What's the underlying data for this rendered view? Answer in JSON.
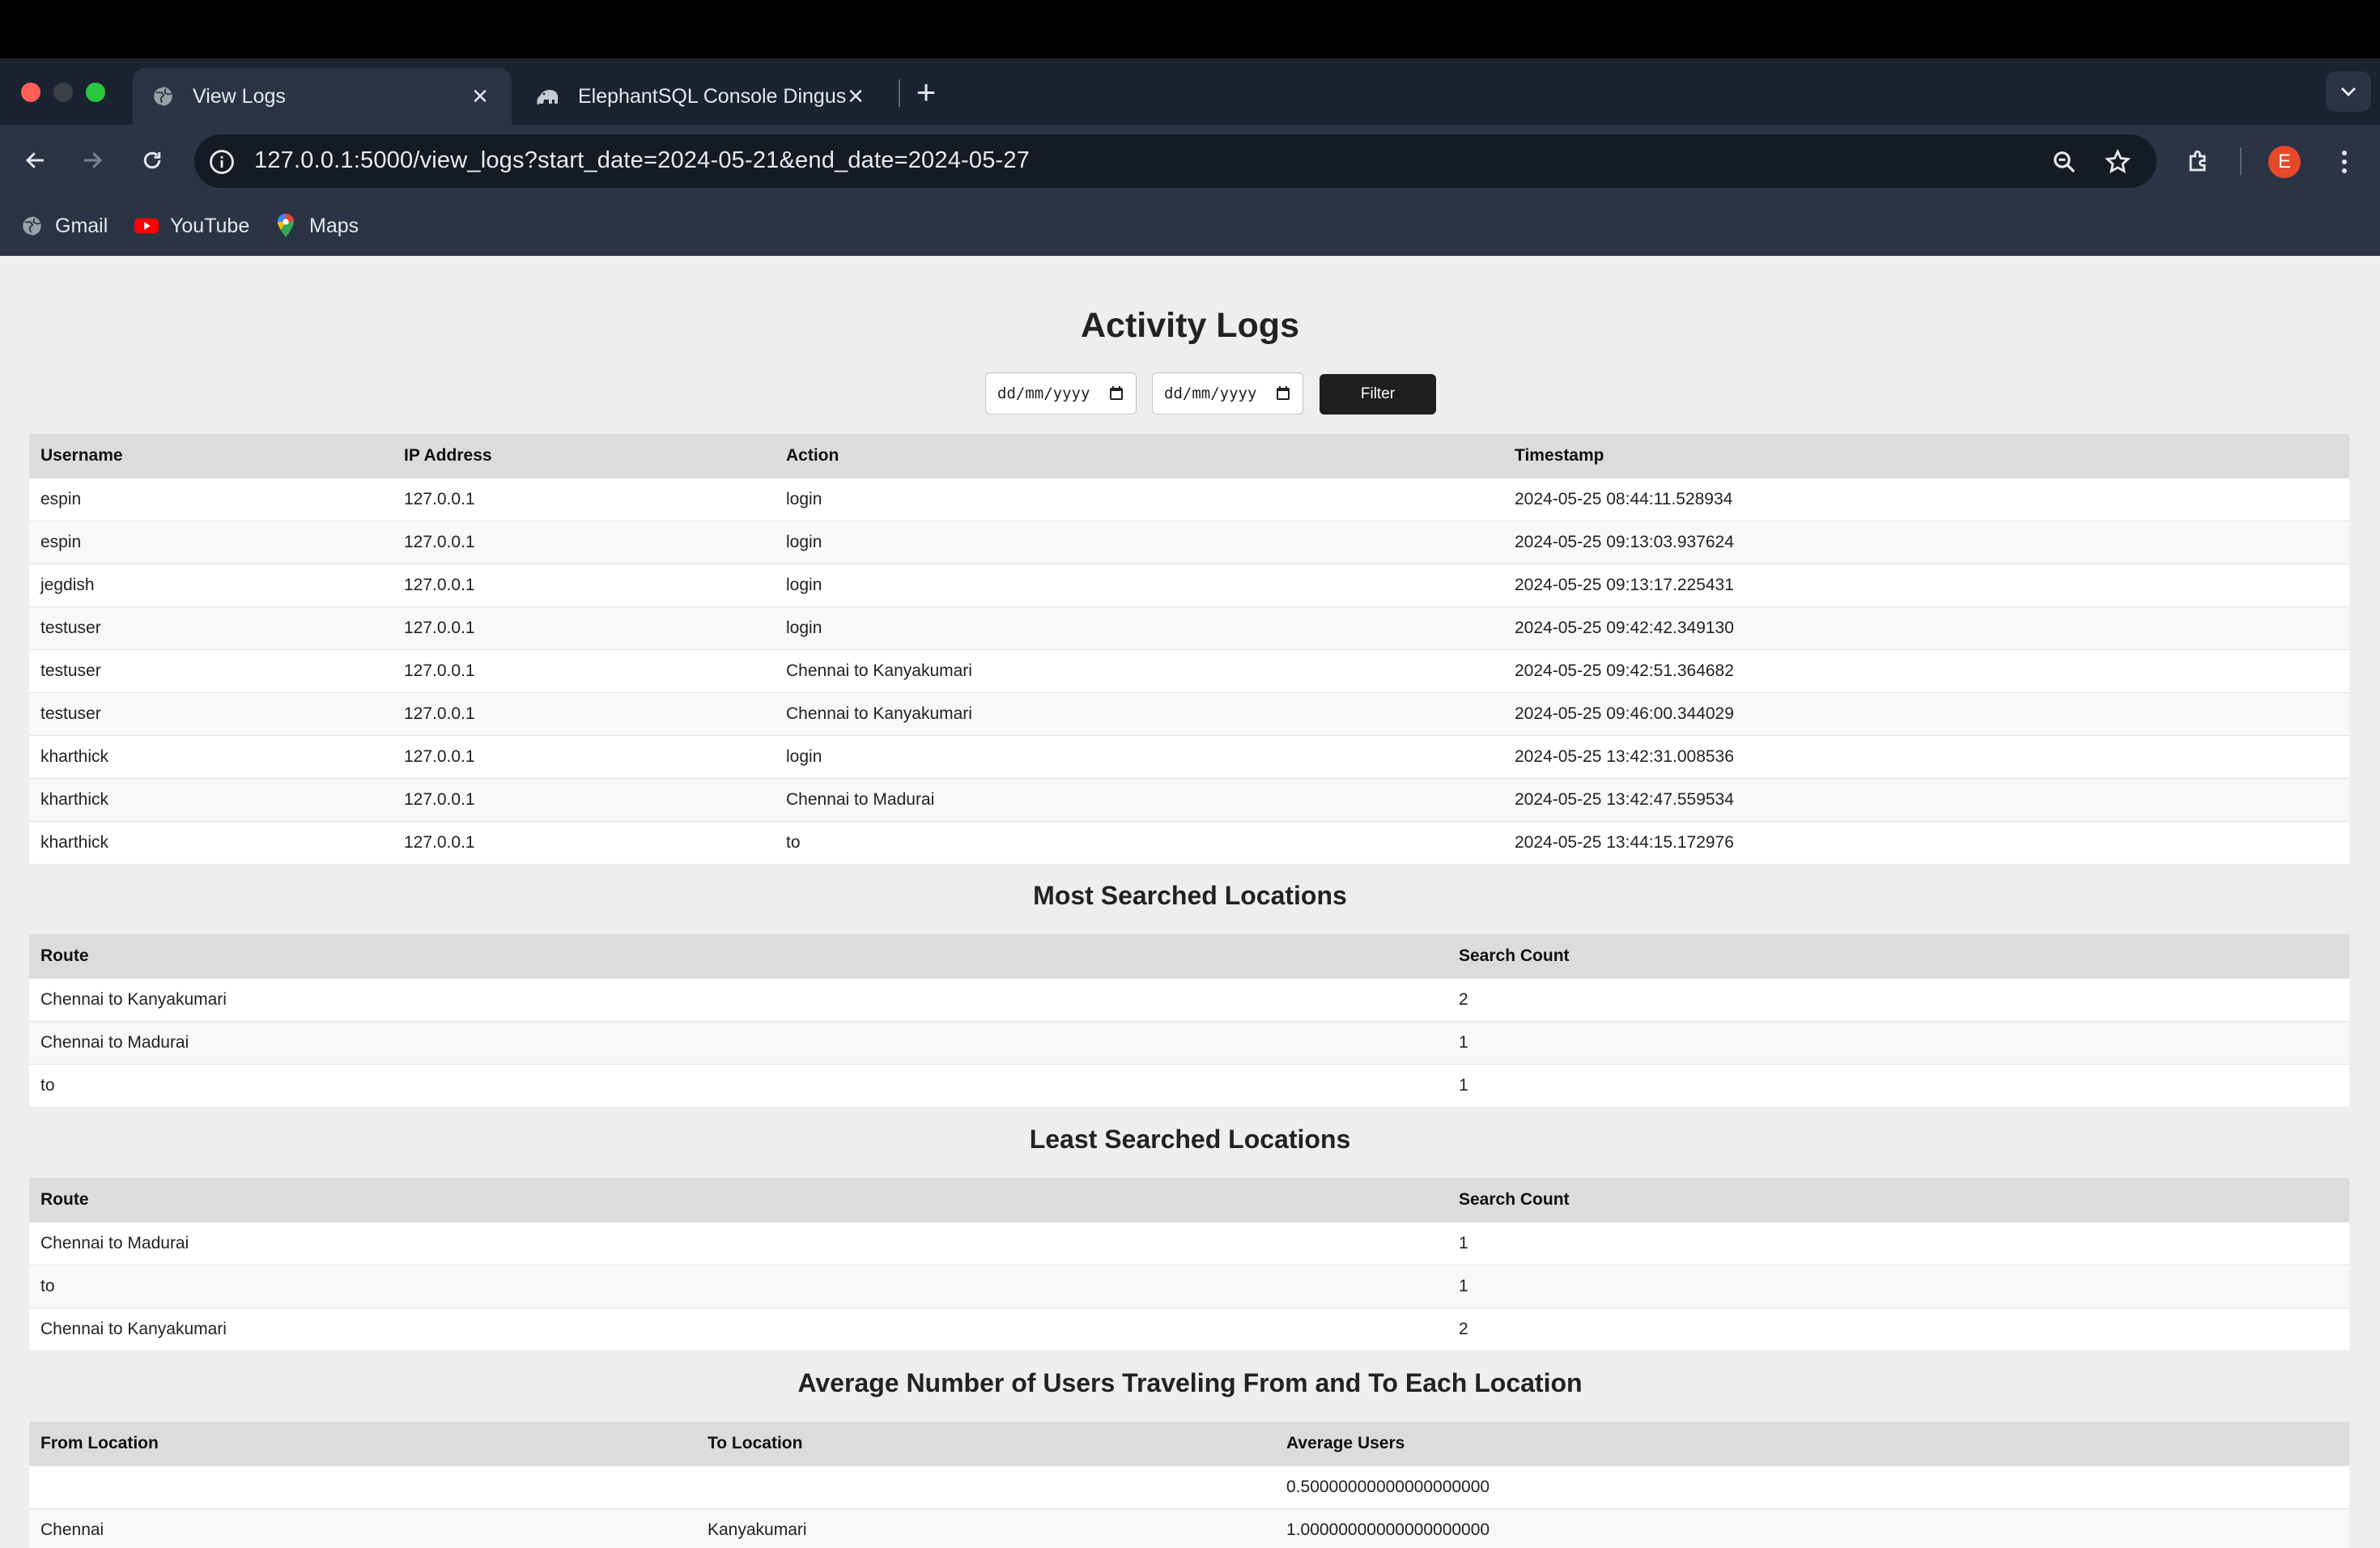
{
  "browser": {
    "tabs": [
      {
        "title": "View Logs",
        "icon": "globe-icon",
        "active": true
      },
      {
        "title": "ElephantSQL Console Dingus",
        "icon": "elephant-icon",
        "active": false
      }
    ],
    "url": "127.0.0.1:5000/view_logs?start_date=2024-05-21&end_date=2024-05-27",
    "profile_initial": "E",
    "bookmarks": [
      {
        "label": "Gmail",
        "icon": "globe-icon"
      },
      {
        "label": "YouTube",
        "icon": "youtube-icon"
      },
      {
        "label": "Maps",
        "icon": "maps-pin-icon"
      }
    ],
    "colors": {
      "chrome_bg": "#1b2330",
      "toolbar_bg": "#2a3444",
      "avatar": "#e5492a"
    }
  },
  "page": {
    "title": "Activity Logs",
    "filter": {
      "start_placeholder": "dd/mm/yyyy",
      "end_placeholder": "dd/mm/yyyy",
      "button_label": "Filter"
    },
    "logs": {
      "headers": [
        "Username",
        "IP Address",
        "Action",
        "Timestamp"
      ],
      "rows": [
        [
          "espin",
          "127.0.0.1",
          "login",
          "2024-05-25 08:44:11.528934"
        ],
        [
          "espin",
          "127.0.0.1",
          "login",
          "2024-05-25 09:13:03.937624"
        ],
        [
          "jegdish",
          "127.0.0.1",
          "login",
          "2024-05-25 09:13:17.225431"
        ],
        [
          "testuser",
          "127.0.0.1",
          "login",
          "2024-05-25 09:42:42.349130"
        ],
        [
          "testuser",
          "127.0.0.1",
          "Chennai to Kanyakumari",
          "2024-05-25 09:42:51.364682"
        ],
        [
          "testuser",
          "127.0.0.1",
          "Chennai to Kanyakumari",
          "2024-05-25 09:46:00.344029"
        ],
        [
          "kharthick",
          "127.0.0.1",
          "login",
          "2024-05-25 13:42:31.008536"
        ],
        [
          "kharthick",
          "127.0.0.1",
          "Chennai to Madurai",
          "2024-05-25 13:42:47.559534"
        ],
        [
          "kharthick",
          "127.0.0.1",
          "to",
          "2024-05-25 13:44:15.172976"
        ]
      ]
    },
    "most_searched": {
      "title": "Most Searched Locations",
      "headers": [
        "Route",
        "Search Count"
      ],
      "rows": [
        [
          "Chennai to Kanyakumari",
          "2"
        ],
        [
          "Chennai to Madurai",
          "1"
        ],
        [
          "to",
          "1"
        ]
      ]
    },
    "least_searched": {
      "title": "Least Searched Locations",
      "headers": [
        "Route",
        "Search Count"
      ],
      "rows": [
        [
          "Chennai to Madurai",
          "1"
        ],
        [
          "to",
          "1"
        ],
        [
          "Chennai to Kanyakumari",
          "2"
        ]
      ]
    },
    "average_users": {
      "title": "Average Number of Users Traveling From and To Each Location",
      "headers": [
        "From Location",
        "To Location",
        "Average Users"
      ],
      "rows": [
        [
          "",
          "",
          "0.50000000000000000000"
        ],
        [
          "Chennai",
          "Kanyakumari",
          "1.00000000000000000000"
        ]
      ]
    }
  }
}
